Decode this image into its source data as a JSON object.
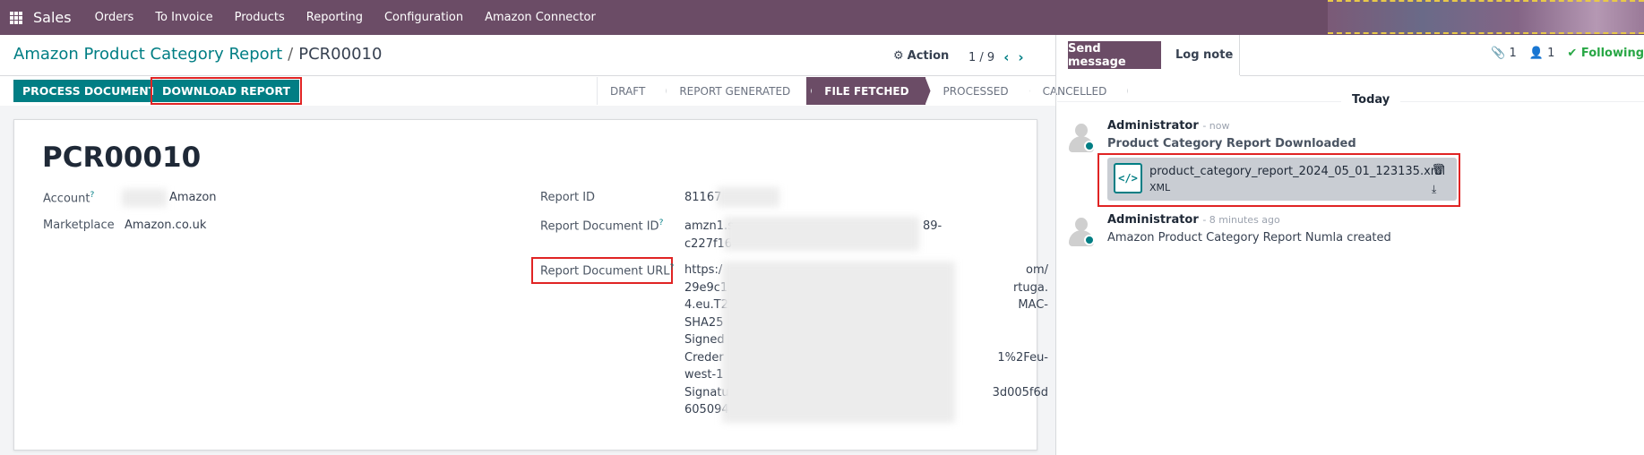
{
  "topnav": {
    "app_name": "Sales",
    "menu": [
      "Orders",
      "To Invoice",
      "Products",
      "Reporting",
      "Configuration",
      "Amazon Connector"
    ]
  },
  "breadcrumb": {
    "parent": "Amazon Product Category Report",
    "separator": "/",
    "current": "PCR00010"
  },
  "control": {
    "action_label": "Action",
    "pager": "1 / 9"
  },
  "buttons": {
    "process": "PROCESS DOCUMENT",
    "download": "DOWNLOAD REPORT"
  },
  "statusbar": {
    "stages": [
      "DRAFT",
      "REPORT GENERATED",
      "FILE FETCHED",
      "PROCESSED",
      "CANCELLED"
    ],
    "active": "FILE FETCHED"
  },
  "form": {
    "title": "PCR00010",
    "left": [
      {
        "label": "Account",
        "help": "?",
        "value": "Amazon"
      },
      {
        "label": "Marketplace",
        "help": "",
        "value": "Amazon.co.uk"
      }
    ],
    "right": {
      "report_id": {
        "label": "Report ID",
        "value": "81167"
      },
      "report_document_id": {
        "label": "Report Document ID",
        "help": "?",
        "lines": [
          "amzn1.s",
          "c227f16"
        ],
        "line_tails": [
          "89-",
          ""
        ]
      },
      "report_document_url": {
        "label": "Report Document URL",
        "help": "?",
        "lines": [
          "https:/",
          "29e9c1",
          "4.eu.T2",
          "SHA25",
          "Signed",
          "Creder",
          "west-1",
          "Signatu",
          "605094"
        ],
        "line_tails": [
          "om/",
          "rtuga.",
          "MAC-",
          "",
          "",
          "1%2Feu-",
          "",
          "3d005f6d",
          ""
        ]
      }
    }
  },
  "chatter": {
    "send_message": "Send message",
    "log_note": "Log note",
    "attachments_count": "1",
    "followers_count": "1",
    "following_label": "Following",
    "date_separator": "Today",
    "messages": [
      {
        "author": "Administrator",
        "time": "- now",
        "body": "Product Category Report Downloaded",
        "attachment": {
          "name": "product_category_report_2024_05_01_123135.xml",
          "type": "XML"
        }
      },
      {
        "author": "Administrator",
        "time": "- 8 minutes ago",
        "body": "Amazon Product Category Report Numla created"
      }
    ]
  },
  "colors": {
    "brand": "#6b4c66",
    "primary": "#017e84",
    "highlight": "#e02424",
    "following": "#28a745"
  }
}
